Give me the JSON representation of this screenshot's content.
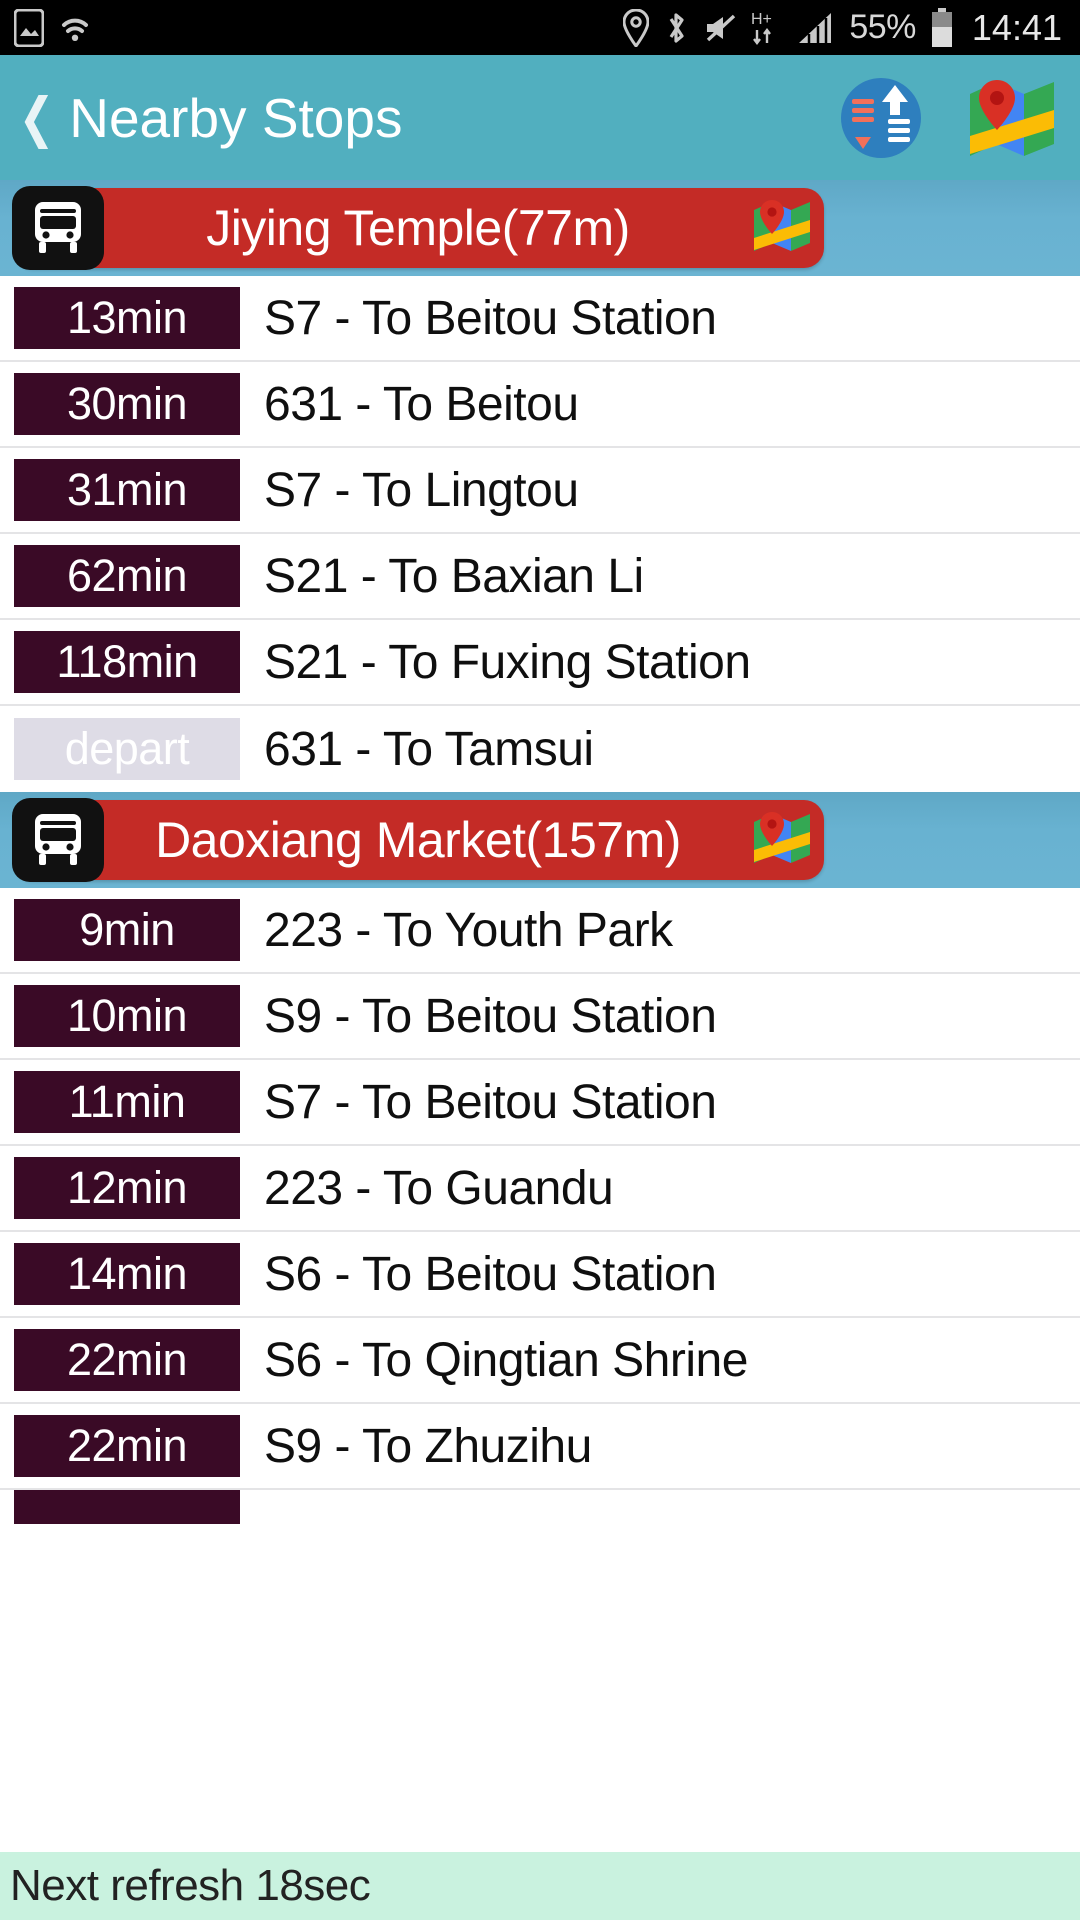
{
  "status_bar": {
    "icons_left": [
      "screenshot-icon",
      "wifi-icon"
    ],
    "icons_right": [
      "location-pin-icon",
      "bluetooth-icon",
      "mute-icon",
      "hplus-data-icon",
      "signal-bars-icon"
    ],
    "battery_percent": "55%",
    "clock": "14:41"
  },
  "app_bar": {
    "back_chevron": "❮",
    "title": "Nearby Stops",
    "sort_icon": "sort-updown-icon",
    "map_icon": "map-icon"
  },
  "colors": {
    "appbar_bg": "#51AFBF",
    "stop_header_bg": "#6BB4D2",
    "stop_banner_bg": "#C42B26",
    "time_badge_bg": "#3A0A26",
    "depart_badge_bg": "#DEDCE6",
    "refresh_bar_bg": "#C9F2DF",
    "row_divider": "#E4E4E6"
  },
  "stops": [
    {
      "name": "Jiying Temple(77m)",
      "bus_icon": "bus-icon",
      "map_icon": "map-icon",
      "arrivals": [
        {
          "time": "13min",
          "is_depart": false,
          "route": "S7 - To Beitou Station"
        },
        {
          "time": "30min",
          "is_depart": false,
          "route": "631 - To Beitou"
        },
        {
          "time": "31min",
          "is_depart": false,
          "route": "S7 - To Lingtou"
        },
        {
          "time": "62min",
          "is_depart": false,
          "route": "S21 - To Baxian Li"
        },
        {
          "time": "118min",
          "is_depart": false,
          "route": "S21 - To Fuxing Station"
        },
        {
          "time": "depart",
          "is_depart": true,
          "route": "631 - To Tamsui"
        }
      ]
    },
    {
      "name": "Daoxiang Market(157m)",
      "bus_icon": "bus-icon",
      "map_icon": "map-icon",
      "arrivals": [
        {
          "time": "9min",
          "is_depart": false,
          "route": "223 - To Youth Park"
        },
        {
          "time": "10min",
          "is_depart": false,
          "route": "S9 - To Beitou Station"
        },
        {
          "time": "11min",
          "is_depart": false,
          "route": "S7 - To Beitou Station"
        },
        {
          "time": "12min",
          "is_depart": false,
          "route": "223 - To Guandu"
        },
        {
          "time": "14min",
          "is_depart": false,
          "route": "S6 - To Beitou Station"
        },
        {
          "time": "22min",
          "is_depart": false,
          "route": "S6 - To Qingtian Shrine"
        },
        {
          "time": "22min",
          "is_depart": false,
          "route": "S9 - To Zhuzihu"
        },
        {
          "time": "",
          "is_depart": false,
          "route": "",
          "clipped": true
        }
      ]
    }
  ],
  "footer": {
    "refresh_text": "Next refresh 18sec"
  }
}
